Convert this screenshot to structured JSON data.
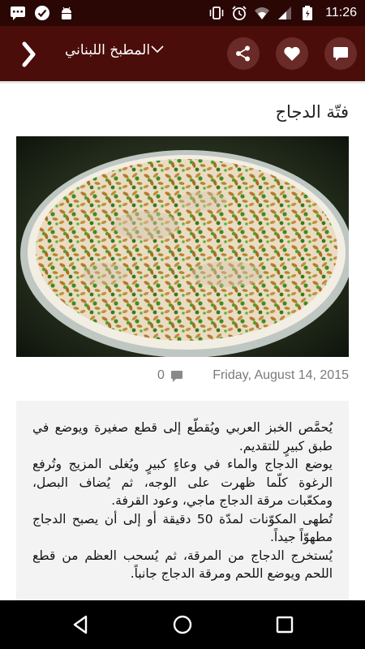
{
  "status_bar": {
    "time": "11:26",
    "left_icons": [
      "chat-notification-icon",
      "check-circle-icon",
      "android-icon"
    ],
    "right_icons": [
      "vibrate-icon",
      "alarm-icon",
      "wifi-icon",
      "signal-icon",
      "battery-icon"
    ]
  },
  "app_bar": {
    "title": "المطبخ اللبناني",
    "actions": [
      "comment-icon",
      "heart-icon",
      "share-icon"
    ],
    "colors": {
      "bar": "#4b0d0a",
      "status": "#2a0605",
      "button": "#6a2a27"
    }
  },
  "article": {
    "title": "فتّة الدجاج",
    "date": "Friday, August 14, 2015",
    "comment_count": "0",
    "image_alt_icon": "dish-photo",
    "body": [
      "يُحمَّص الخبز العربي ويُقطّع إلى قطع صغيرة ويوضع في طبق كبيرٍ للتقديم.",
      "يوضع الدجاج والماء في وعاءٍ كبيرٍ ويُغلى المزيج وتُرفع الرغوة كلّما ظهرت على الوجه، ثم يُضاف البصل، ومكعّبات مرقة الدجاج ماجي، وعود القرفة.",
      "تُطهى المكوّنات لمدّة 50 دقيقة أو إلى أن يصبح الدجاج مطهوّاً جيداً.",
      "يُستخرج الدجاج من المرقة، ثم يُسحب العظم من قطع اللحم ويوضع اللحم ومرقة الدجاج جانباً."
    ]
  },
  "nav_bar": {
    "icons": [
      "back-triangle-icon",
      "home-circle-icon",
      "recents-square-icon"
    ]
  }
}
